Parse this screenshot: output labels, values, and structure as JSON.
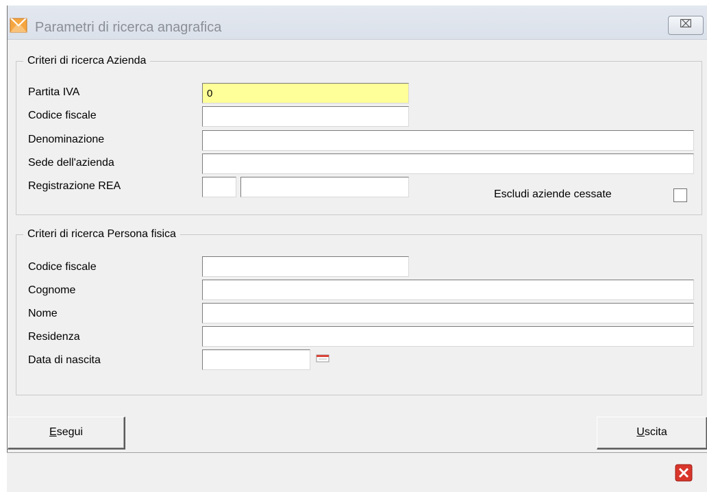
{
  "window": {
    "title": "Parametri di ricerca anagrafica",
    "close_glyph": "⌧"
  },
  "azienda": {
    "legend": "Criteri di ricerca Azienda",
    "partita_iva": {
      "label": "Partita IVA",
      "value": "0"
    },
    "codice_fiscale": {
      "label": "Codice fiscale",
      "value": ""
    },
    "denominazione": {
      "label": "Denominazione",
      "value": ""
    },
    "sede": {
      "label": "Sede dell'azienda",
      "value": ""
    },
    "rea": {
      "label": "Registrazione REA",
      "value_prov": "",
      "value_num": ""
    },
    "escludi": {
      "label": "Escludi aziende cessate",
      "checked": false
    }
  },
  "persona": {
    "legend": "Criteri di ricerca Persona fisica",
    "codice_fiscale": {
      "label": "Codice fiscale",
      "value": ""
    },
    "cognome": {
      "label": "Cognome",
      "value": ""
    },
    "nome": {
      "label": "Nome",
      "value": ""
    },
    "residenza": {
      "label": "Residenza",
      "value": ""
    },
    "data_nascita": {
      "label": "Data di nascita",
      "value": ""
    }
  },
  "buttons": {
    "esegui": {
      "mnemonic": "E",
      "rest": "segui"
    },
    "uscita": {
      "mnemonic": "U",
      "rest": "scita"
    }
  },
  "icons": {
    "app": "app-envelope-icon",
    "calendar": "calendar-icon",
    "status_close": "red-close-icon"
  },
  "colors": {
    "active_field": "#ffff99",
    "status_close": "#d9362b"
  }
}
